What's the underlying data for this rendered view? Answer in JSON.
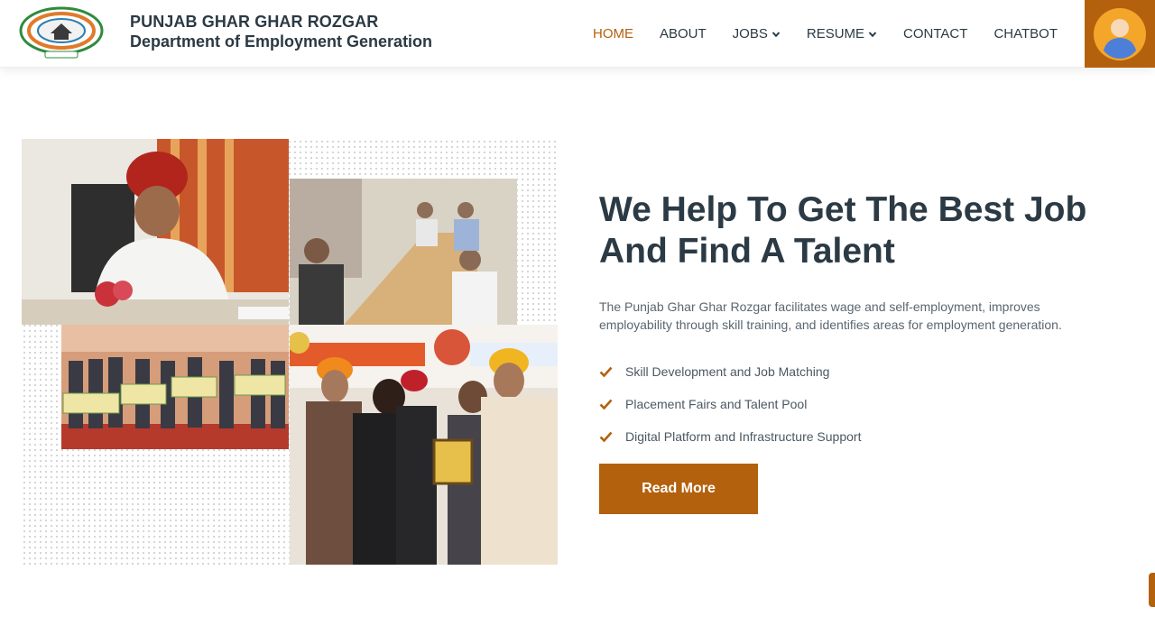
{
  "header": {
    "title": "PUNJAB GHAR GHAR ROZGAR",
    "subtitle": "Department of Employment Generation",
    "nav": [
      {
        "label": "HOME",
        "active": true
      },
      {
        "label": "ABOUT"
      },
      {
        "label": "JOBS",
        "dropdown": true
      },
      {
        "label": "RESUME",
        "dropdown": true
      },
      {
        "label": "CONTACT"
      },
      {
        "label": "CHATBOT"
      }
    ],
    "user_icon": "user-avatar-icon"
  },
  "hero": {
    "headline_line1": "We Help To Get The Best Job",
    "headline_line2": "And Find A Talent",
    "description": "The Punjab Ghar Ghar Rozgar facilitates wage and self-employment, improves employability through skill training, and identifies areas for employment generation.",
    "features": [
      "Skill Development and Job Matching",
      "Placement Fairs and Talent Pool",
      "Digital Platform and Infrastructure Support"
    ],
    "button_label": "Read More"
  },
  "colors": {
    "accent": "#b4610d",
    "heading": "#2b3a44",
    "text": "#5a6670"
  }
}
